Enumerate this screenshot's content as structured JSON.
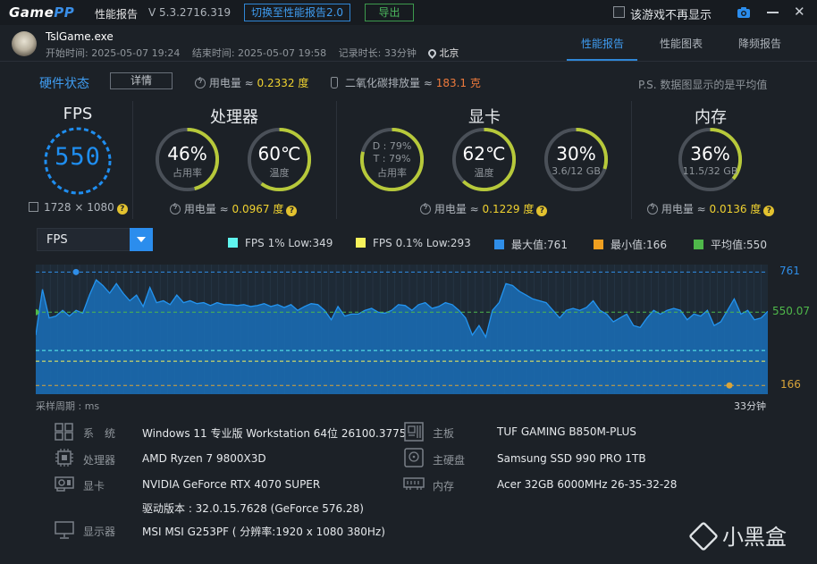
{
  "titlebar": {
    "logo_game": "Game",
    "logo_pp": "PP",
    "report_title": "性能报告",
    "version": "V 5.3.2716.319",
    "switch_button": "切换至性能报告2.0",
    "export_button": "导出",
    "nodisplay_label": "该游戏不再显示",
    "close_glyph": "✕"
  },
  "header": {
    "exe_name": "TslGame.exe",
    "start_time": "开始时间: 2025-05-07 19:24",
    "end_time": "结束时间: 2025-05-07 19:58",
    "duration": "记录时长: 33分钟",
    "location": "北京",
    "tabs": [
      "性能报告",
      "性能图表",
      "降频报告"
    ]
  },
  "hw": {
    "title": "硬件状态",
    "details_button": "详情",
    "power_label": "用电量 ≈ ",
    "power_value": "0.2332 度",
    "co2_label": "二氧化碳排放量 ≈ ",
    "co2_value": "183.1 克",
    "ps_note": "P.S. 数据图显示的是平均值"
  },
  "fps_panel": {
    "title": "FPS",
    "value": "550",
    "resolution": "1728 × 1080",
    "help": "?"
  },
  "cpu_panel": {
    "title": "处理器",
    "usage": {
      "value": "46%",
      "label": "占用率",
      "fraction": 0.46
    },
    "temp": {
      "value": "60℃",
      "label": "温度",
      "fraction": 0.6
    },
    "power_label": "用电量 ≈ ",
    "power_value": "0.0967 度"
  },
  "gpu_panel": {
    "title": "显卡",
    "usage": {
      "d_line": "D : 79%",
      "t_line": "T : 79%",
      "label": "占用率",
      "fraction": 0.79
    },
    "temp": {
      "value": "62℃",
      "label": "温度",
      "fraction": 0.62
    },
    "vram": {
      "value": "30%",
      "label": "3.6/12 GB",
      "fraction": 0.3
    },
    "power_label": "用电量 ≈ ",
    "power_value": "0.1229 度"
  },
  "mem_panel": {
    "title": "内存",
    "usage": {
      "value": "36%",
      "label": "11.5/32 GB",
      "fraction": 0.36
    },
    "power_label": "用电量 ≈ ",
    "power_value": "0.0136 度"
  },
  "chart_controls": {
    "select_value": "FPS",
    "legend": [
      {
        "label": "FPS 1% Low:349",
        "color": "#5ff5ef"
      },
      {
        "label": "FPS 0.1% Low:293",
        "color": "#f7f25b"
      },
      {
        "label": "最大值:761",
        "color": "#2f8ee8"
      },
      {
        "label": "最小值:166",
        "color": "#f0a020"
      },
      {
        "label": "平均值:550",
        "color": "#4fb84a"
      }
    ],
    "sample_label": "采样周期 : ms",
    "duration_label": "33分钟"
  },
  "chart_data": {
    "type": "area",
    "ylim": [
      120,
      800
    ],
    "max": 761,
    "min": 166,
    "avg": 550.07,
    "low_1pct": 349,
    "low_01pct": 293,
    "max_label": "761",
    "min_label": "166",
    "avg_label": "550.07",
    "colors": {
      "fill": "#1a6fb8",
      "line": "#2394f0",
      "max": "#2f8ee8",
      "min": "#d9a43a",
      "avg": "#4fb84a",
      "low1": "#5ff5ef",
      "low01": "#f7f25b"
    },
    "values": [
      430,
      670,
      520,
      530,
      560,
      530,
      560,
      545,
      640,
      720,
      690,
      650,
      700,
      650,
      610,
      640,
      580,
      680,
      600,
      610,
      590,
      640,
      600,
      610,
      595,
      600,
      585,
      600,
      590,
      590,
      585,
      590,
      580,
      585,
      595,
      580,
      590,
      575,
      590,
      560,
      580,
      595,
      590,
      560,
      510,
      580,
      530,
      540,
      540,
      560,
      570,
      550,
      545,
      560,
      590,
      585,
      560,
      590,
      600,
      570,
      580,
      600,
      590,
      560,
      520,
      430,
      480,
      420,
      560,
      600,
      700,
      690,
      660,
      640,
      620,
      610,
      600,
      560,
      520,
      560,
      570,
      560,
      575,
      610,
      560,
      540,
      500,
      520,
      540,
      480,
      470,
      520,
      560,
      540,
      560,
      570,
      560,
      510,
      540,
      530,
      560,
      480,
      500,
      560,
      620,
      540,
      560,
      510,
      520,
      555
    ]
  },
  "sysinfo": {
    "left": [
      {
        "key": "系　统",
        "value": "Windows 11 专业版 Workstation 64位 26100.3775"
      },
      {
        "key": "处理器",
        "value": "AMD Ryzen 7 9800X3D"
      },
      {
        "key": "显卡",
        "value": "NVIDIA GeForce RTX 4070 SUPER"
      },
      {
        "key": "",
        "value": "驱动版本 : 32.0.15.7628 (GeForce 576.28)"
      },
      {
        "key": "显示器",
        "value": "MSI MSI G253PF ( 分辨率:1920 x 1080 380Hz)"
      }
    ],
    "right": [
      {
        "key": "主板",
        "value": "TUF GAMING B850M-PLUS"
      },
      {
        "key": "主硬盘",
        "value": "Samsung SSD 990 PRO 1TB"
      },
      {
        "key": "内存",
        "value": "Acer 32GB 6000MHz 26-35-32-28"
      }
    ]
  },
  "watermark": "小黑盒"
}
